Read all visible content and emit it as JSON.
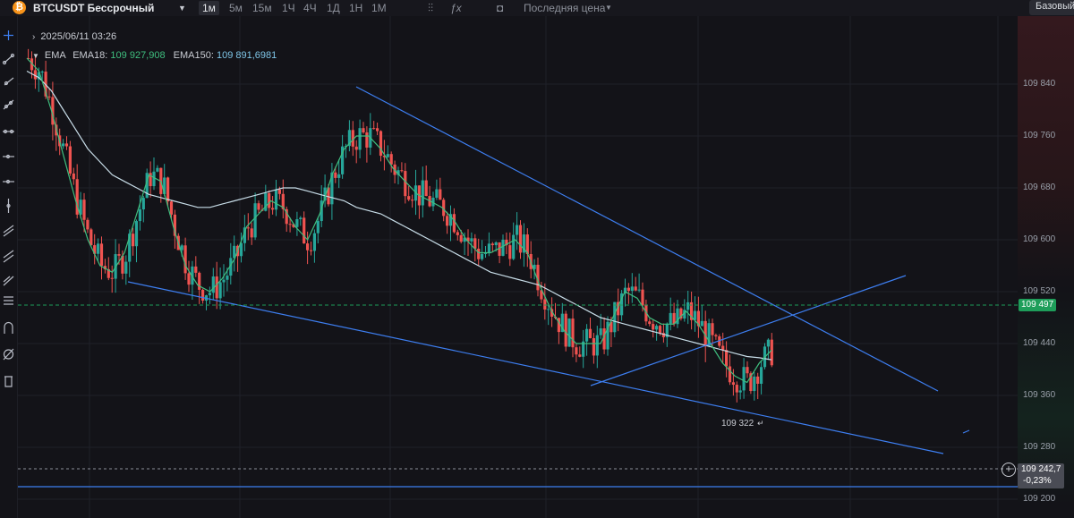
{
  "header": {
    "symbol": "BTCUSDT Бессрочный",
    "timeframes": [
      "1м",
      "5м",
      "15м",
      "1Ч",
      "4Ч",
      "1Д",
      "1Н",
      "1М"
    ],
    "active_timeframe": "1м",
    "price_source": "Последняя цена",
    "mode_button": "Базовый"
  },
  "legend": {
    "datetime": "2025/06/11 03:26",
    "ema_label": "EMA",
    "ema18_label": "EMA18:",
    "ema18_value": "109 927,908",
    "ema150_label": "EMA150:",
    "ema150_value": "109 891,6981"
  },
  "price_axis": {
    "ticks": [
      "109 840",
      "109 760",
      "109 680",
      "109 600",
      "109 520",
      "109 440",
      "109 360",
      "109 280",
      "109 200"
    ],
    "current_price": "109 497",
    "crosshair_price": "109 242,7",
    "crosshair_change": "-0,23%"
  },
  "annotations": {
    "low_label": "109 322"
  },
  "colors": {
    "up": "#26a69a",
    "down": "#ef5350",
    "ema18": "#3fbf7f",
    "ema150": "#c8dde8",
    "trendline": "#3d7ef0",
    "current_price_tag": "#1e9e5a"
  },
  "chart_data": {
    "type": "line",
    "title": "BTCUSDT Бессрочный",
    "xlabel": "",
    "ylabel": "",
    "ylim": [
      109180,
      109900
    ],
    "grid": true,
    "series": [
      {
        "name": "EMA18",
        "values": [
          109880,
          109860,
          109800,
          109730,
          109660,
          109600,
          109560,
          109550,
          109580,
          109640,
          109700,
          109690,
          109620,
          109560,
          109530,
          109520,
          109540,
          109570,
          109620,
          109640,
          109660,
          109650,
          109620,
          109600,
          109640,
          109700,
          109740,
          109760,
          109760,
          109740,
          109710,
          109690,
          109670,
          109660,
          109650,
          109630,
          109600,
          109580,
          109580,
          109590,
          109600,
          109580,
          109530,
          109490,
          109460,
          109440,
          109440,
          109440,
          109480,
          109520,
          109510,
          109480,
          109470,
          109470,
          109490,
          109470,
          109440,
          109410,
          109390,
          109380,
          109410,
          109430
        ]
      },
      {
        "name": "EMA150",
        "values": [
          109860,
          109850,
          109830,
          109800,
          109770,
          109740,
          109720,
          109700,
          109690,
          109680,
          109670,
          109665,
          109660,
          109655,
          109650,
          109650,
          109655,
          109660,
          109665,
          109670,
          109675,
          109680,
          109680,
          109675,
          109670,
          109665,
          109660,
          109650,
          109645,
          109640,
          109630,
          109620,
          109610,
          109600,
          109590,
          109580,
          109570,
          109560,
          109550,
          109545,
          109540,
          109535,
          109530,
          109520,
          109510,
          109500,
          109490,
          109480,
          109475,
          109470,
          109465,
          109460,
          109455,
          109450,
          109445,
          109440,
          109435,
          109430,
          109425,
          109420,
          109418,
          109415
        ]
      }
    ]
  }
}
